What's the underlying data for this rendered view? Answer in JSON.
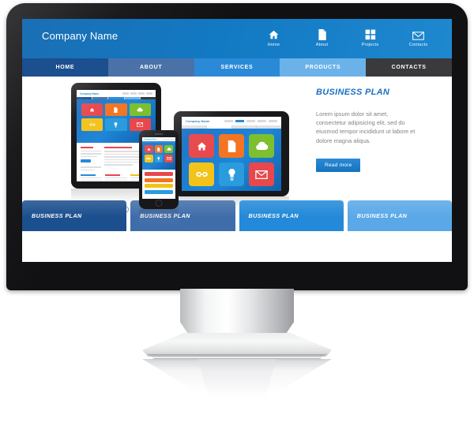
{
  "site": {
    "company_name": "Company Name",
    "header_icons": [
      {
        "label": "Home",
        "icon": "home-icon"
      },
      {
        "label": "About",
        "icon": "document-icon"
      },
      {
        "label": "Projects",
        "icon": "grid-icon"
      },
      {
        "label": "Contacts",
        "icon": "envelope-icon"
      }
    ],
    "nav": [
      {
        "label": "HOME",
        "color": "#1b4f8e"
      },
      {
        "label": "ABOUT",
        "color": "#4a72a8"
      },
      {
        "label": "SERVICES",
        "color": "#2a8ad8"
      },
      {
        "label": "PRODUCTS",
        "color": "#6bb2ea"
      },
      {
        "label": "CONTACTS",
        "color": "#3a3a3c"
      }
    ],
    "hero": {
      "title": "BUSINESS PLAN",
      "body": "Lorem ipsum dolor sit amet, consectetur adipisicing elit, sed do eiusmod tempor incididunt ut labore et dolore magna aliqua.",
      "button": "Read more",
      "dots": [
        {
          "active": true
        },
        {
          "active": false
        },
        {
          "active": false
        }
      ]
    },
    "promos": [
      {
        "label": "BUSINESS PLAN",
        "color": "#1c4f8e"
      },
      {
        "label": "BUSINESS PLAN",
        "color": "#3f6daa"
      },
      {
        "label": "BUSINESS PLAN",
        "color": "#2389d8"
      },
      {
        "label": "BUSINESS PLAN",
        "color": "#5aa8e8"
      }
    ],
    "device_mockup": {
      "brand": "Company Name",
      "tiles": [
        {
          "icon": "home-icon",
          "color": "#e8474b"
        },
        {
          "icon": "document-icon",
          "color": "#f47421"
        },
        {
          "icon": "cloud-icon",
          "color": "#7dbf2f"
        },
        {
          "icon": "link-icon",
          "color": "#f3c31a"
        },
        {
          "icon": "lightbulb-icon",
          "color": "#2a9bdc"
        },
        {
          "icon": "envelope-icon",
          "color": "#e8474b"
        }
      ],
      "phone_bars": [
        "#e8474b",
        "#f47421",
        "#f3c31a",
        "#2a9bdc"
      ]
    },
    "colors": {
      "header_blue": "#1279c3",
      "accent_blue": "#1b6fc0",
      "button_blue": "#1c7fd0",
      "bezel_black": "#111113",
      "stand_silver": "#e4e5e7"
    }
  }
}
